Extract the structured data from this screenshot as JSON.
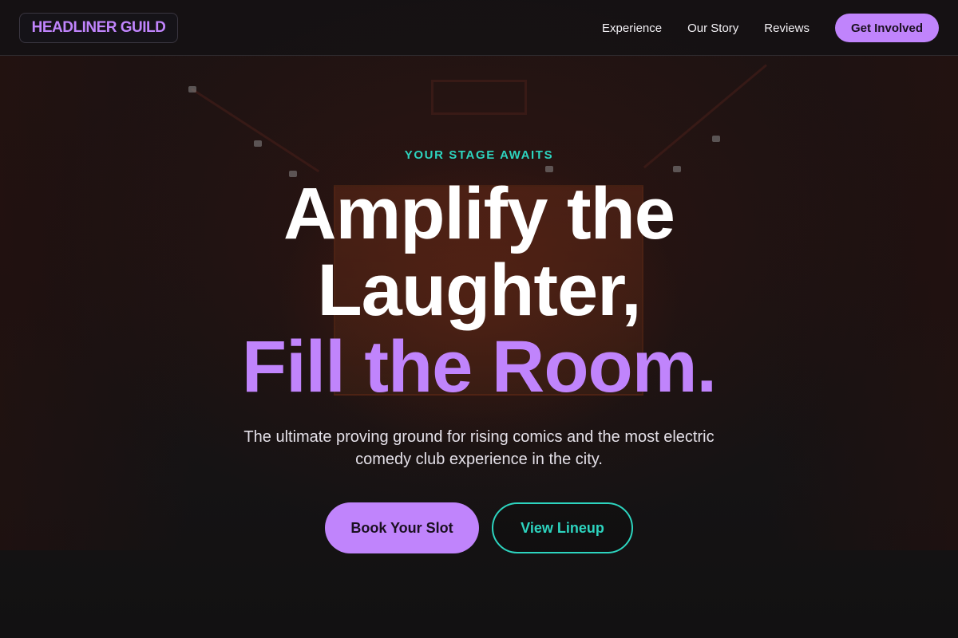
{
  "header": {
    "logo": "HEADLINER GUILD",
    "nav": [
      {
        "label": "Experience"
      },
      {
        "label": "Our Story"
      },
      {
        "label": "Reviews"
      }
    ],
    "cta_label": "Get Involved"
  },
  "hero": {
    "eyebrow": "YOUR STAGE AWAITS",
    "headline_line1": "Amplify the",
    "headline_line2": "Laughter,",
    "headline_accent": "Fill the Room.",
    "subtitle": "The ultimate proving ground for rising comics and the most electric comedy club experience in the city.",
    "primary_button": "Book Your Slot",
    "secondary_button": "View Lineup"
  },
  "colors": {
    "accent_purple": "#c084fc",
    "accent_teal": "#2dd4bf",
    "background": "#141214"
  }
}
